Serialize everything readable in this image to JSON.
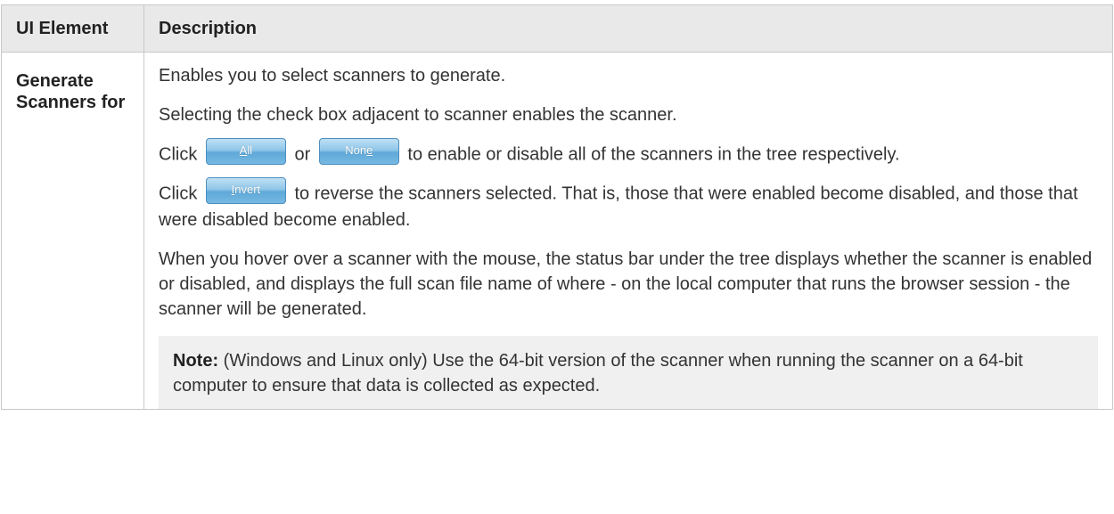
{
  "table": {
    "header": {
      "col1": "UI Element",
      "col2": "Description"
    },
    "rows": [
      {
        "element": "Generate Scanners for",
        "description": {
          "p1": "Enables you to select scanners to generate.",
          "p2": "Selecting the check box adjacent to scanner enables the scanner.",
          "p3": {
            "prefix": "Click",
            "button_all": {
              "label_pre": "",
              "mnemonic": "A",
              "label_post": "ll"
            },
            "middle": "or",
            "button_none": {
              "label_pre": "Non",
              "mnemonic": "e",
              "label_post": ""
            },
            "suffix": "to enable or disable all of the scanners in the tree respectively."
          },
          "p4": {
            "prefix": "Click",
            "button_invert": {
              "label_pre": "",
              "mnemonic": "I",
              "label_post": "nvert"
            },
            "suffix": "to reverse the scanners selected. That is, those that were enabled become disabled, and those that were disabled become enabled."
          },
          "p5": "When you hover over a scanner with the mouse, the status bar under the tree displays whether the scanner is enabled or disabled, and displays the full scan file name of where - on the local computer that runs the browser session - the scanner will be generated.",
          "note": {
            "label": "Note:",
            "text": " (Windows and Linux only) Use the 64-bit version of the scanner when running the scanner on a 64-bit computer to ensure that data is collected as expected."
          }
        }
      }
    ]
  }
}
